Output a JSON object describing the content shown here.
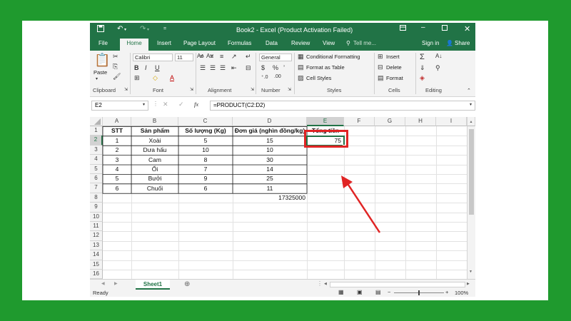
{
  "title_bar": {
    "save_icon": "save-icon",
    "undo_icon": "undo-icon",
    "redo_icon": "redo-icon",
    "customize_icon": "customize-quick-access-icon",
    "title": "Book2 - Excel (Product Activation Failed)",
    "ribbon_options_icon": "ribbon-display-options-icon",
    "minimize_icon": "minimize-icon",
    "maximize_icon": "maximize-icon",
    "close_icon": "close-icon"
  },
  "tabs": [
    "File",
    "Home",
    "Insert",
    "Page Layout",
    "Formulas",
    "Data",
    "Review",
    "View"
  ],
  "tell_me": "Tell me...",
  "sign_in": "Sign in",
  "share": "Share",
  "ribbon": {
    "clipboard": {
      "paste": "Paste",
      "label": "Clipboard"
    },
    "font": {
      "name": "Calibri",
      "size": "11",
      "bold": "B",
      "italic": "I",
      "underline": "U",
      "grow": "A˄",
      "shrink": "A˅",
      "label": "Font"
    },
    "alignment": {
      "label": "Alignment"
    },
    "number": {
      "format": "General",
      "currency": "$",
      "percent": "%",
      "comma": "’",
      "label": "Number"
    },
    "styles": {
      "conditional": "Conditional Formatting",
      "table": "Format as Table",
      "cell_styles": "Cell Styles",
      "label": "Styles"
    },
    "cells": {
      "insert": "Insert",
      "delete": "Delete",
      "format": "Format",
      "label": "Cells"
    },
    "editing": {
      "label": "Editing"
    }
  },
  "formula_bar": {
    "name_box": "E2",
    "fx": "fx",
    "formula": "=PRODUCT(C2:D2)"
  },
  "columns": [
    "A",
    "B",
    "C",
    "D",
    "E",
    "F",
    "G",
    "H",
    "I"
  ],
  "rows": [
    "1",
    "2",
    "3",
    "4",
    "5",
    "6",
    "7",
    "8",
    "9",
    "10",
    "11",
    "12",
    "13",
    "14",
    "15",
    "16"
  ],
  "headers": {
    "stt": "STT",
    "product": "Sản phẩm",
    "qty": "Số lượng (Kg)",
    "price": "Đơn giá (nghìn đồng/kg)",
    "total": "Tổng tiền"
  },
  "table_rows": [
    {
      "stt": "1",
      "product": "Xoài",
      "qty": "5",
      "price": "15",
      "total": "75"
    },
    {
      "stt": "2",
      "product": "Dưa hấu",
      "qty": "10",
      "price": "10",
      "total": ""
    },
    {
      "stt": "3",
      "product": "Cam",
      "qty": "8",
      "price": "30",
      "total": ""
    },
    {
      "stt": "4",
      "product": "Ổi",
      "qty": "7",
      "price": "14",
      "total": ""
    },
    {
      "stt": "5",
      "product": "Bưởi",
      "qty": "9",
      "price": "25",
      "total": ""
    },
    {
      "stt": "6",
      "product": "Chuối",
      "qty": "6",
      "price": "11",
      "total": ""
    }
  ],
  "d8_value": "17325000",
  "sheet_tab": "Sheet1",
  "status": {
    "ready": "Ready",
    "zoom": "100%"
  },
  "colors": {
    "excel_green": "#217346",
    "highlight_red": "#e02424",
    "background": "#1f9a2e"
  }
}
